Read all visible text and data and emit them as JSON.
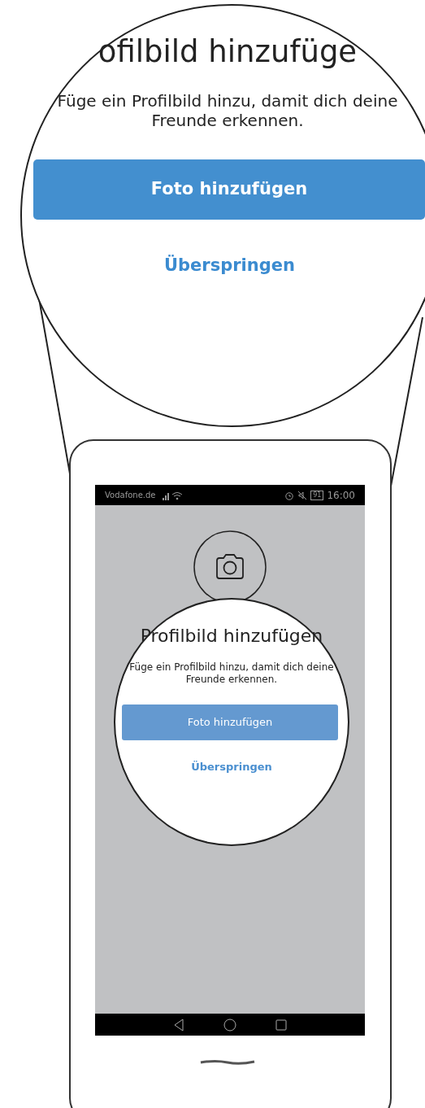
{
  "magnified": {
    "title": "ofilbild hinzufüge",
    "subtitle": "Füge ein Profilbild hinzu, damit dich deine Freunde erkennen.",
    "primary_button": "Foto hinzufügen",
    "skip_link": "Überspringen"
  },
  "status_bar": {
    "carrier": "Vodafone.de",
    "battery": "91",
    "time": "16:00"
  },
  "screen": {
    "title": "Profilbild hinzufügen",
    "subtitle": "Füge ein Profilbild hinzu, damit dich deine Freunde erkennen.",
    "primary_button": "Foto hinzufügen",
    "skip_link": "Überspringen"
  }
}
